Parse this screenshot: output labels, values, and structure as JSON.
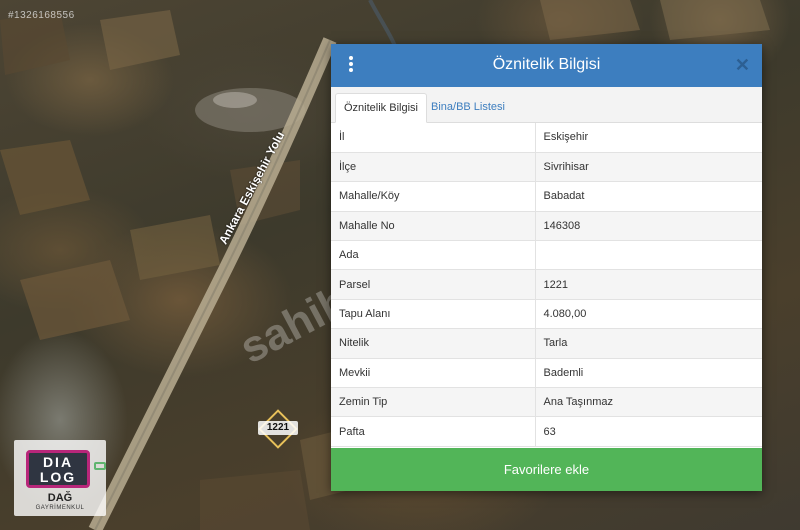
{
  "map": {
    "listing_id": "#1326168556",
    "road_label": "Ankara Eskişehir Yolu",
    "watermark": "sahibinden",
    "parcel_marker": "1221"
  },
  "logo": {
    "box_text": "DIA\nLOG",
    "brand": "DAĞ",
    "subtitle": "GAYRİMENKUL"
  },
  "dialog": {
    "title": "Öznitelik Bilgisi",
    "menu_icon": "vertical-dots-icon",
    "close_icon": "close-icon",
    "tabs": [
      {
        "label": "Öznitelik Bilgisi",
        "active": true
      },
      {
        "label": "Bina/BB Listesi",
        "active": false
      }
    ],
    "rows": [
      {
        "key": "İl",
        "value": "Eskişehir"
      },
      {
        "key": "İlçe",
        "value": "Sivrihisar"
      },
      {
        "key": "Mahalle/Köy",
        "value": "Babadat"
      },
      {
        "key": "Mahalle No",
        "value": "146308"
      },
      {
        "key": "Ada",
        "value": ""
      },
      {
        "key": "Parsel",
        "value": "1221"
      },
      {
        "key": "Tapu Alanı",
        "value": "4.080,00"
      },
      {
        "key": "Nitelik",
        "value": "Tarla"
      },
      {
        "key": "Mevkii",
        "value": "Bademli"
      },
      {
        "key": "Zemin Tip",
        "value": "Ana Taşınmaz"
      },
      {
        "key": "Pafta",
        "value": "63"
      }
    ],
    "favorite_button": "Favorilere ekle"
  },
  "colors": {
    "header": "#3d7ebf",
    "button": "#52b558",
    "road": "#b8ad92"
  }
}
